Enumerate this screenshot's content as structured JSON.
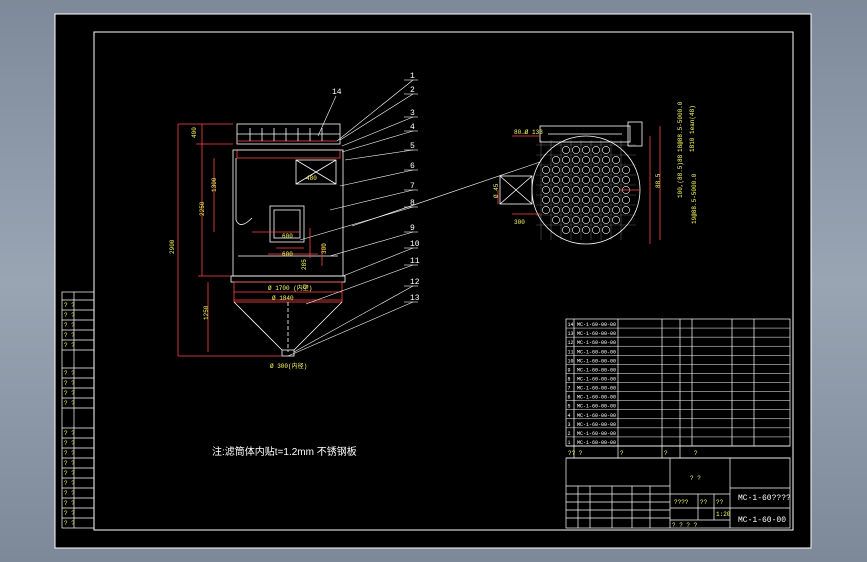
{
  "drawing": {
    "note": "注:滤筒体内贴t=1.2mm 不锈钢板",
    "callouts": [
      "1",
      "2",
      "3",
      "4",
      "5",
      "6",
      "7",
      "8",
      "9",
      "10",
      "11",
      "12",
      "13",
      "14"
    ],
    "dims": {
      "h_total": "2900",
      "h_upper": "2250",
      "h_1300": "1300",
      "h_1250": "1250",
      "h_400": "400",
      "d_1700": "Ø 1700 (内壁)",
      "d_1840": "Ø 1840",
      "d_300": "Ø 300(内径)",
      "dim_600a": "600",
      "dim_600b": "600",
      "dim_480": "480",
      "dim_300": "300",
      "dim_285": "285",
      "plan_top": "80→Ø 133",
      "plan_45": "Ø 45",
      "plan_300": "300",
      "plan_88": "88.5",
      "plan_right1": "18@88.5-5000.0",
      "plan_right2": "100,(88.5)88",
      "plan_right3": "1810 1ean(48)",
      "plan_right4": "19@88.5-5000.0"
    },
    "bom": {
      "rows": [
        {
          "no": "14",
          "code": "MC-1-60-00-00"
        },
        {
          "no": "13",
          "code": "MC-1-60-00-00"
        },
        {
          "no": "12",
          "code": "MC-1-60-00-00"
        },
        {
          "no": "11",
          "code": "MC-1-60-00-00"
        },
        {
          "no": "10",
          "code": "MC-1-60-00-00"
        },
        {
          "no": "9",
          "code": "MC-1-60-00-00"
        },
        {
          "no": "8",
          "code": "MC-1-60-00-00"
        },
        {
          "no": "7",
          "code": "MC-1-60-00-00"
        },
        {
          "no": "6",
          "code": "MC-1-60-00-00"
        },
        {
          "no": "5",
          "code": "MC-1-60-00-00"
        },
        {
          "no": "4",
          "code": "MC-1-60-00-00"
        },
        {
          "no": "3",
          "code": "MC-1-60-00-00"
        },
        {
          "no": "2",
          "code": "MC-1-60-00-00"
        },
        {
          "no": "1",
          "code": "MC-1-60-00-00"
        }
      ],
      "q": "??  ?",
      "q2": "?",
      "q3": "?",
      "q4": "?"
    },
    "title": {
      "name": "MC-1-60????",
      "code": "MC-1-60-00",
      "mid1": "? ?",
      "mid2": "????",
      "mid3": "??",
      "mid4": "??",
      "scale": "1:20",
      "sheet": "? ?  ?  ?"
    },
    "left_strip": [
      "? ?",
      "? ?",
      "? ?",
      "? ?",
      "? ?",
      "? ?",
      "? ?",
      "? ?",
      "? ?",
      "? ?",
      "? ?",
      "? ?",
      "? ?",
      "? ?",
      "? ?",
      "? ?",
      "? ?",
      "? ?",
      "? ?",
      "? ?"
    ]
  }
}
